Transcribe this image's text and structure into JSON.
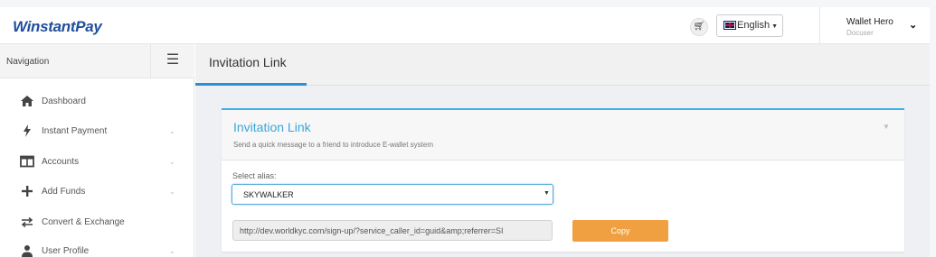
{
  "header": {
    "logo": "WinstantPay",
    "cart_icon": "cart-icon",
    "language": "English",
    "user_name": "Wallet Hero",
    "user_role": "Docuser"
  },
  "sidebar": {
    "title": "Navigation",
    "toggle_icon": "hamburger-icon",
    "items": [
      {
        "label": "Dashboard",
        "icon": "home-icon",
        "expandable": false
      },
      {
        "label": "Instant Payment",
        "icon": "bolt-icon",
        "expandable": true
      },
      {
        "label": "Accounts",
        "icon": "columns-icon",
        "expandable": true
      },
      {
        "label": "Add Funds",
        "icon": "plus-icon",
        "expandable": true
      },
      {
        "label": "Convert & Exchange",
        "icon": "exchange-icon",
        "expandable": false
      },
      {
        "label": "User Profile",
        "icon": "user-icon",
        "expandable": true
      }
    ]
  },
  "page": {
    "title": "Invitation Link"
  },
  "card": {
    "title": "Invitation Link",
    "subtitle": "Send a quick message to a friend to introduce E-wallet system",
    "alias_label": "Select alias:",
    "alias_value": "SKYWALKER",
    "link_value": "http://dev.worldkyc.com/sign-up/?service_caller_id=guid&amp;referrer=SI",
    "copy_label": "Copy"
  },
  "colors": {
    "brand": "#1f4f9c",
    "accent": "#3aa6d8",
    "copy_button": "#f0a040"
  }
}
